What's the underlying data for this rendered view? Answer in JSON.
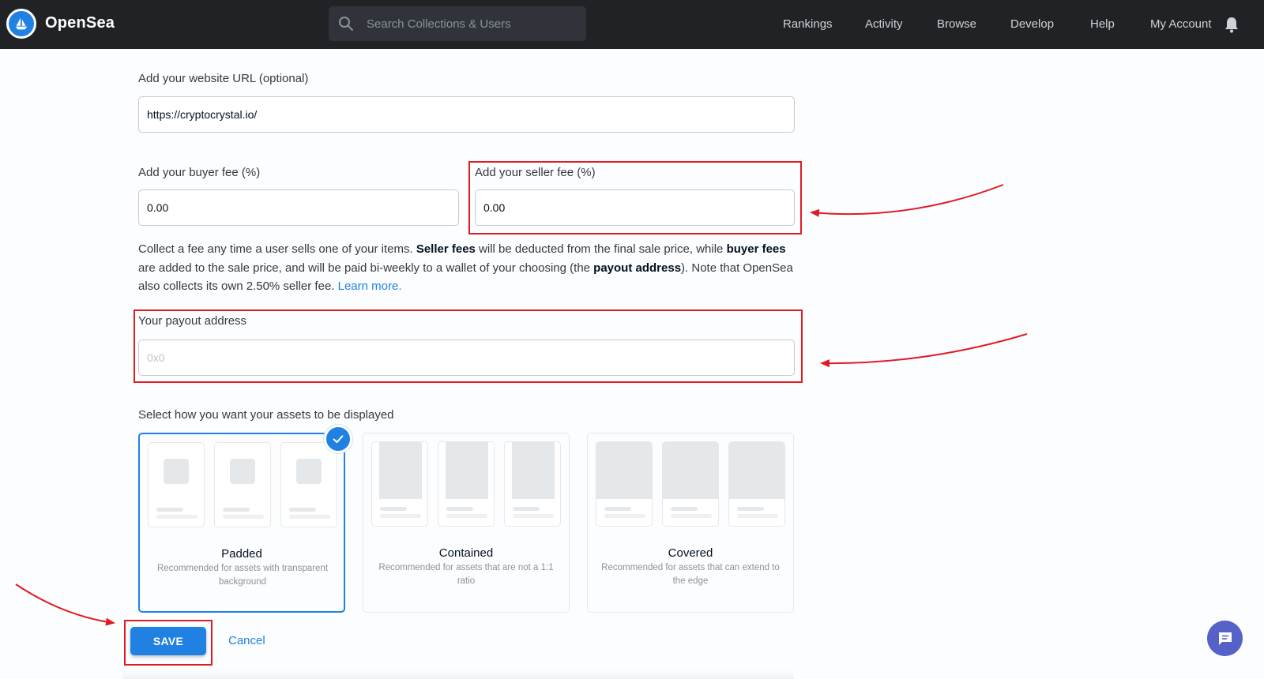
{
  "header": {
    "brand": "OpenSea",
    "search_placeholder": "Search Collections & Users",
    "nav": [
      "Rankings",
      "Activity",
      "Browse",
      "Develop",
      "Help",
      "My Account"
    ],
    "colors": {
      "bar": "#202225",
      "accent": "#2081e2"
    }
  },
  "form": {
    "website": {
      "label": "Add your website URL (optional)",
      "value": "https://cryptocrystal.io/"
    },
    "buyer_fee": {
      "label": "Add your buyer fee (%)",
      "value": "0.00"
    },
    "seller_fee": {
      "label": "Add your seller fee (%)",
      "value": "0.00"
    },
    "description": {
      "part1": "Collect a fee any time a user sells one of your items. ",
      "seller_fees": "Seller fees",
      "part2": " will be deducted from the final sale price, while ",
      "buyer_fees": "buyer fees",
      "part3": " are added to the sale price, and will be paid bi-weekly to a wallet of your choosing (the ",
      "payout_address": "payout address",
      "part4": "). Note that OpenSea also collects its own 2.50% seller fee. ",
      "learn_more": "Learn more."
    },
    "payout": {
      "label": "Your payout address",
      "placeholder": "0x0",
      "value": ""
    },
    "display": {
      "label": "Select how you want your assets to be displayed",
      "selected": "Padded",
      "options": [
        {
          "title": "Padded",
          "desc": "Recommended for assets with transparent background"
        },
        {
          "title": "Contained",
          "desc": "Recommended for assets that are not a 1:1 ratio"
        },
        {
          "title": "Covered",
          "desc": "Recommended for assets that can extend to the edge"
        }
      ]
    },
    "save_label": "SAVE",
    "cancel_label": "Cancel"
  },
  "icons": {
    "logo": "opensea-ship-icon",
    "search": "search-icon",
    "bell": "bell-icon",
    "check": "check-icon",
    "chat": "chat-icon"
  },
  "annotation_color": "#e01b24"
}
